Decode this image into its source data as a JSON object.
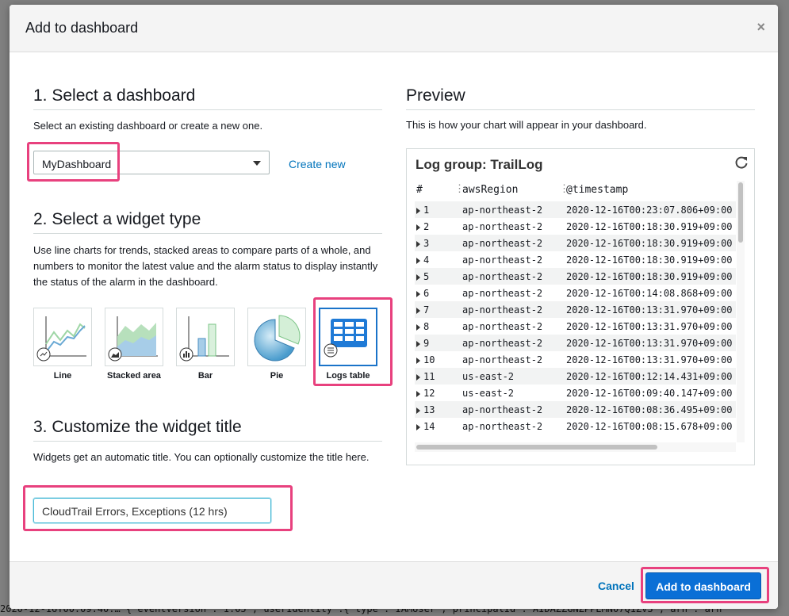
{
  "background": {
    "mono_fragment": "2020-12-16T00:09:40.…  { eventVersion : 1.05 , userIdentity :{ type : IAMUser , principalId : AIDAZZGNZPPEMN07Q1ZV3 , arn : arn"
  },
  "modal": {
    "title": "Add to dashboard",
    "close_label": "×"
  },
  "section1": {
    "heading": "1. Select a dashboard",
    "description": "Select an existing dashboard or create a new one.",
    "dashboard_select_value": "MyDashboard",
    "create_new_label": "Create new"
  },
  "section2": {
    "heading": "2. Select a widget type",
    "description": "Use line charts for trends, stacked areas to compare parts of a whole, and numbers to monitor the latest value and the alarm status to display instantly the status of the alarm in the dashboard.",
    "widgets": [
      {
        "label": "Line"
      },
      {
        "label": "Stacked area"
      },
      {
        "label": "Bar"
      },
      {
        "label": "Pie"
      },
      {
        "label": "Logs table"
      }
    ],
    "selected": "Logs table"
  },
  "section3": {
    "heading": "3. Customize the widget title",
    "description": "Widgets get an automatic title. You can optionally customize the title here.",
    "title_value": "CloudTrail Errors, Exceptions (12 hrs)"
  },
  "preview": {
    "heading": "Preview",
    "description": "This is how your chart will appear in your dashboard.",
    "box_title": "Log group: TrailLog",
    "columns": [
      "#",
      "awsRegion",
      "@timestamp"
    ],
    "rows": [
      {
        "num": "1",
        "region": "ap-northeast-2",
        "ts": "2020-12-16T00:23:07.806+09:00"
      },
      {
        "num": "2",
        "region": "ap-northeast-2",
        "ts": "2020-12-16T00:18:30.919+09:00"
      },
      {
        "num": "3",
        "region": "ap-northeast-2",
        "ts": "2020-12-16T00:18:30.919+09:00"
      },
      {
        "num": "4",
        "region": "ap-northeast-2",
        "ts": "2020-12-16T00:18:30.919+09:00"
      },
      {
        "num": "5",
        "region": "ap-northeast-2",
        "ts": "2020-12-16T00:18:30.919+09:00"
      },
      {
        "num": "6",
        "region": "ap-northeast-2",
        "ts": "2020-12-16T00:14:08.868+09:00"
      },
      {
        "num": "7",
        "region": "ap-northeast-2",
        "ts": "2020-12-16T00:13:31.970+09:00"
      },
      {
        "num": "8",
        "region": "ap-northeast-2",
        "ts": "2020-12-16T00:13:31.970+09:00"
      },
      {
        "num": "9",
        "region": "ap-northeast-2",
        "ts": "2020-12-16T00:13:31.970+09:00"
      },
      {
        "num": "10",
        "region": "ap-northeast-2",
        "ts": "2020-12-16T00:13:31.970+09:00"
      },
      {
        "num": "11",
        "region": "us-east-2",
        "ts": "2020-12-16T00:12:14.431+09:00"
      },
      {
        "num": "12",
        "region": "us-east-2",
        "ts": "2020-12-16T00:09:40.147+09:00"
      },
      {
        "num": "13",
        "region": "ap-northeast-2",
        "ts": "2020-12-16T00:08:36.495+09:00"
      },
      {
        "num": "14",
        "region": "ap-northeast-2",
        "ts": "2020-12-16T00:08:15.678+09:00"
      }
    ]
  },
  "footer": {
    "cancel_label": "Cancel",
    "submit_label": "Add to dashboard"
  },
  "colors": {
    "highlight": "#e8417e",
    "link": "#0073bb",
    "primary": "#0a6fd6"
  }
}
